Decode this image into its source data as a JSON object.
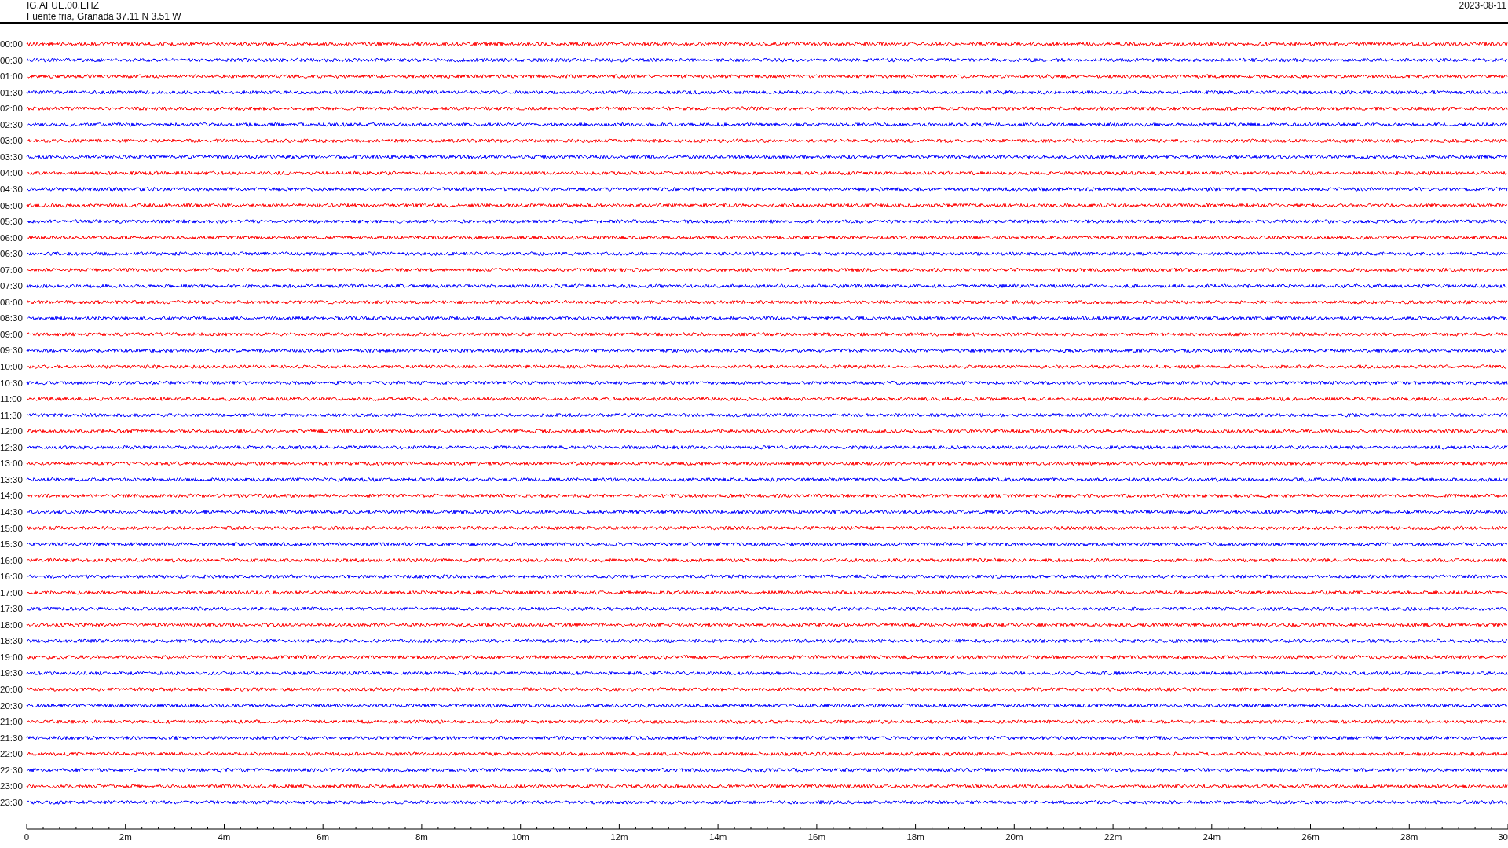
{
  "header": {
    "station": "IG.AFUE.00.EHZ",
    "location": "Fuente fria, Granada  37.11 N 3.51 W",
    "date": "2023-08-11"
  },
  "traces": [
    {
      "time": "00:00",
      "color": "#ff0000"
    },
    {
      "time": "00:30",
      "color": "#0000ff"
    },
    {
      "time": "01:00",
      "color": "#ff0000"
    },
    {
      "time": "01:30",
      "color": "#0000ff"
    },
    {
      "time": "02:00",
      "color": "#ff0000"
    },
    {
      "time": "02:30",
      "color": "#0000ff"
    },
    {
      "time": "03:00",
      "color": "#ff0000"
    },
    {
      "time": "03:30",
      "color": "#0000ff"
    },
    {
      "time": "04:00",
      "color": "#ff0000"
    },
    {
      "time": "04:30",
      "color": "#0000ff"
    },
    {
      "time": "05:00",
      "color": "#ff0000"
    },
    {
      "time": "05:30",
      "color": "#0000ff"
    },
    {
      "time": "06:00",
      "color": "#ff0000"
    },
    {
      "time": "06:30",
      "color": "#0000ff"
    },
    {
      "time": "07:00",
      "color": "#ff0000"
    },
    {
      "time": "07:30",
      "color": "#0000ff"
    },
    {
      "time": "08:00",
      "color": "#ff0000"
    },
    {
      "time": "08:30",
      "color": "#0000ff"
    },
    {
      "time": "09:00",
      "color": "#ff0000"
    },
    {
      "time": "09:30",
      "color": "#0000ff"
    },
    {
      "time": "10:00",
      "color": "#ff0000"
    },
    {
      "time": "10:30",
      "color": "#0000ff"
    },
    {
      "time": "11:00",
      "color": "#ff0000"
    },
    {
      "time": "11:30",
      "color": "#0000ff"
    },
    {
      "time": "12:00",
      "color": "#ff0000"
    },
    {
      "time": "12:30",
      "color": "#0000ff"
    },
    {
      "time": "13:00",
      "color": "#ff0000"
    },
    {
      "time": "13:30",
      "color": "#0000ff"
    },
    {
      "time": "14:00",
      "color": "#ff0000"
    },
    {
      "time": "14:30",
      "color": "#0000ff"
    },
    {
      "time": "15:00",
      "color": "#ff0000"
    },
    {
      "time": "15:30",
      "color": "#0000ff"
    },
    {
      "time": "16:00",
      "color": "#ff0000"
    },
    {
      "time": "16:30",
      "color": "#0000ff"
    },
    {
      "time": "17:00",
      "color": "#ff0000"
    },
    {
      "time": "17:30",
      "color": "#0000ff"
    },
    {
      "time": "18:00",
      "color": "#ff0000"
    },
    {
      "time": "18:30",
      "color": "#0000ff"
    },
    {
      "time": "19:00",
      "color": "#ff0000"
    },
    {
      "time": "19:30",
      "color": "#0000ff"
    },
    {
      "time": "20:00",
      "color": "#ff0000"
    },
    {
      "time": "20:30",
      "color": "#0000ff"
    },
    {
      "time": "21:00",
      "color": "#ff0000"
    },
    {
      "time": "21:30",
      "color": "#0000ff"
    },
    {
      "time": "22:00",
      "color": "#ff0000"
    },
    {
      "time": "22:30",
      "color": "#0000ff"
    },
    {
      "time": "23:00",
      "color": "#ff0000"
    },
    {
      "time": "23:30",
      "color": "#0000ff"
    }
  ],
  "x_axis": {
    "labels": [
      "0",
      "2m",
      "4m",
      "6m",
      "8m",
      "10m",
      "12m",
      "14m",
      "16m",
      "18m",
      "20m",
      "22m",
      "24m",
      "26m",
      "28m",
      "30"
    ]
  }
}
